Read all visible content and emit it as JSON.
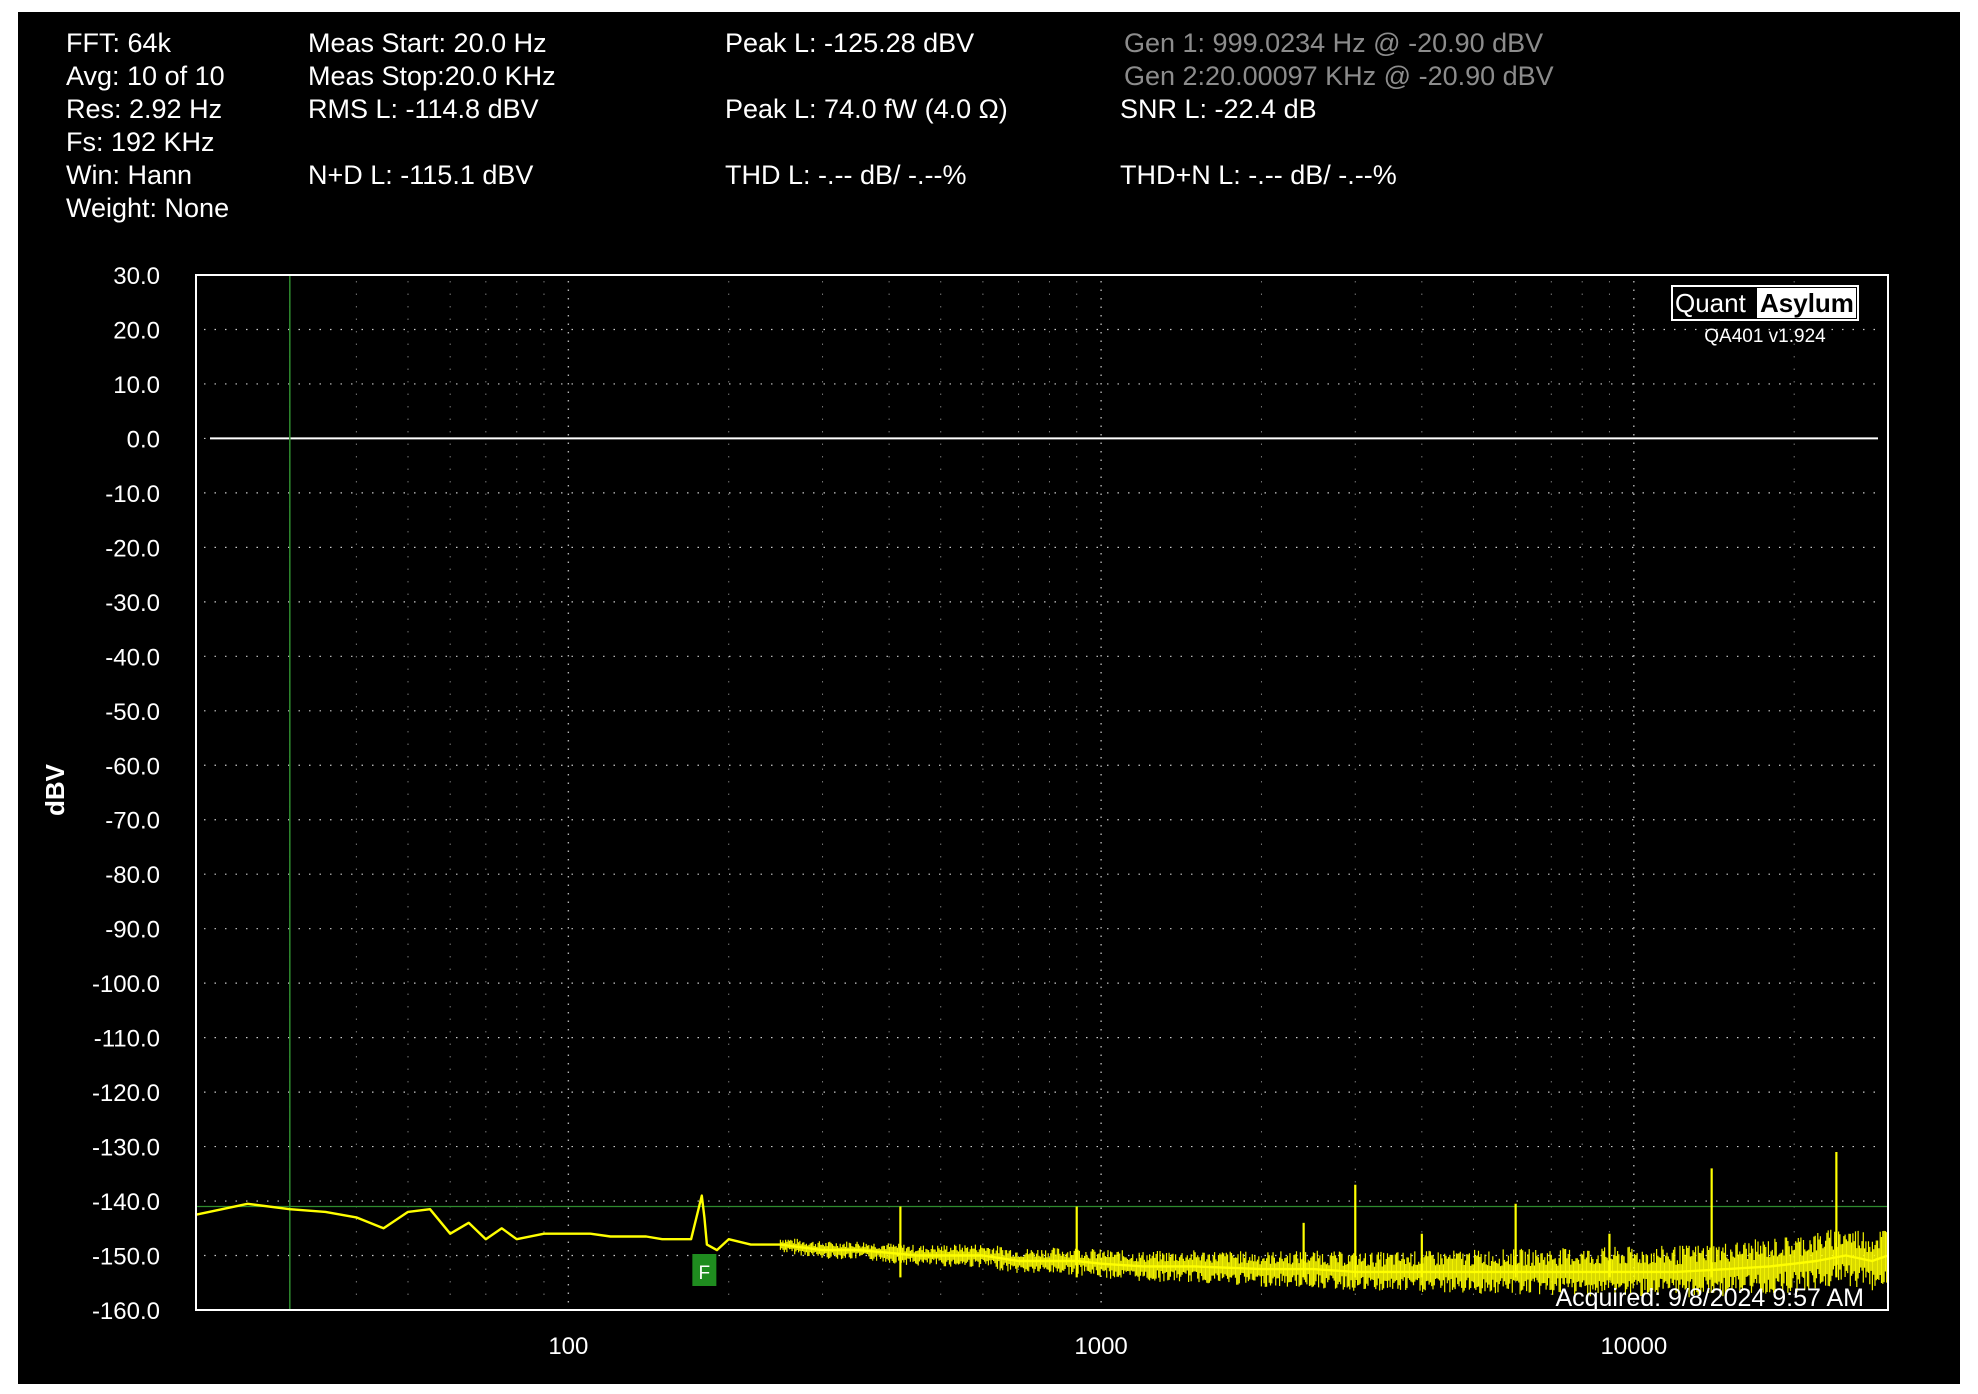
{
  "header": {
    "fft": "FFT: 64k",
    "avg": "Avg: 10 of 10",
    "res": "Res: 2.92 Hz",
    "fs": "Fs: 192 KHz",
    "win": "Win: Hann",
    "weight": "Weight: None",
    "meas_start": "Meas Start: 20.0 Hz",
    "meas_stop": "Meas Stop:20.0 KHz",
    "rms": "RMS L: -114.8 dBV",
    "nd": "N+D L: -115.1 dBV",
    "peak_dbv": "Peak L: -125.28 dBV",
    "peak_w": "Peak L: 74.0 fW (4.0 Ω)",
    "thd": "THD L: -.-- dB/ -.--%",
    "gen1": "Gen 1: 999.0234 Hz @ -20.90  dBV",
    "gen2": "Gen 2:20.00097 KHz @ -20.90  dBV",
    "snr": "SNR L: -22.4 dB",
    "thdn": "THD+N L: -.-- dB/ -.--%"
  },
  "logo": {
    "word1": "Quant",
    "word2": "Asylum",
    "version": "QA401 v1.924"
  },
  "acquired": "Acquired: 9/8/2024  9:57 AM",
  "marker_label": "F",
  "colors": {
    "trace": "#ffff00",
    "grid": "#c8c8c8",
    "cursor": "#2e8b2e",
    "marker": "#1f8c1f"
  },
  "chart_data": {
    "type": "line",
    "ylabel": "dBV",
    "xscale": "log",
    "xlim": [
      20,
      30000
    ],
    "ylim": [
      -160,
      30
    ],
    "yticks": [
      30,
      20,
      10,
      0,
      -10,
      -20,
      -30,
      -40,
      -50,
      -60,
      -70,
      -80,
      -90,
      -100,
      -110,
      -120,
      -130,
      -140,
      -150,
      -160
    ],
    "ytick_labels": [
      "30.0",
      "20.0",
      "10.0",
      "0.0",
      "-10.0",
      "-20.0",
      "-30.0",
      "-40.0",
      "-50.0",
      "-60.0",
      "-70.0",
      "-80.0",
      "-90.0",
      "-100.0",
      "-110.0",
      "-120.0",
      "-130.0",
      "-140.0",
      "-150.0",
      "-160.0"
    ],
    "xticks": [
      100,
      1000,
      10000
    ],
    "xtick_labels": [
      "100",
      "1000",
      "10000"
    ],
    "grid": true,
    "reference_line_dbv": 0,
    "limit_line_dbv": -141,
    "cursor_hz": 30,
    "marker_hz": 180,
    "series": [
      {
        "x": [
          20,
          25,
          30,
          35,
          40,
          45,
          50,
          55,
          60,
          65,
          70,
          75,
          80,
          90,
          100,
          110,
          120,
          130,
          140,
          150,
          160,
          170,
          178,
          180,
          182,
          190,
          200,
          220,
          250,
          300,
          350,
          400,
          450,
          500,
          600,
          700,
          800,
          900,
          1000,
          1200,
          1500,
          2000,
          2500,
          3000,
          3500,
          4000,
          5000,
          6000,
          7000,
          8000,
          9000,
          10000,
          12000,
          15000,
          18000,
          20000,
          22000,
          25000,
          28000,
          30000
        ],
        "y": [
          -142.5,
          -140.5,
          -141.5,
          -142,
          -143,
          -145,
          -142,
          -141.5,
          -146,
          -144,
          -147,
          -145,
          -147,
          -146,
          -146,
          -146,
          -146.5,
          -146.5,
          -146.5,
          -147,
          -147,
          -147,
          -139,
          -143,
          -148,
          -149,
          -147,
          -148,
          -148,
          -149,
          -149,
          -149.5,
          -150,
          -150,
          -150,
          -151,
          -151,
          -151,
          -151.5,
          -152,
          -152,
          -152.5,
          -152.5,
          -153,
          -153,
          -153,
          -153,
          -153,
          -153,
          -153,
          -153,
          -153,
          -153,
          -152.5,
          -152,
          -151.5,
          -151,
          -150,
          -151,
          -150
        ]
      }
    ],
    "spurs": [
      {
        "x": 420,
        "y": -141
      },
      {
        "x": 900,
        "y": -141
      },
      {
        "x": 2400,
        "y": -144
      },
      {
        "x": 3000,
        "y": -137
      },
      {
        "x": 4000,
        "y": -146
      },
      {
        "x": 6000,
        "y": -140.5
      },
      {
        "x": 9000,
        "y": -146
      },
      {
        "x": 14000,
        "y": -134
      },
      {
        "x": 24000,
        "y": -131
      }
    ]
  }
}
